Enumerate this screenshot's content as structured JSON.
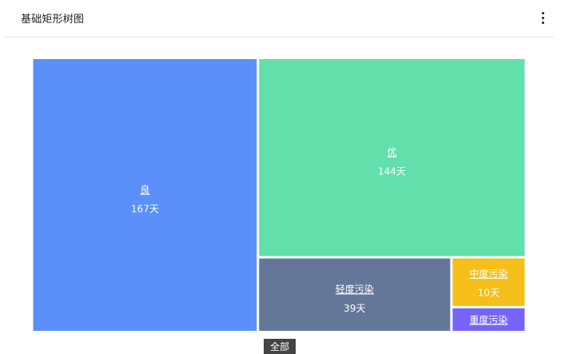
{
  "header": {
    "title": "基础矩形树图",
    "menu_icon": "more-vertical-icon"
  },
  "breadcrumb": {
    "label": "全部"
  },
  "chart_data": {
    "type": "treemap",
    "unit": "天",
    "items": [
      {
        "name": "良",
        "value": 167,
        "value_label": "167天",
        "color": "#5b8ff9"
      },
      {
        "name": "优",
        "value": 144,
        "value_label": "144天",
        "color": "#62dfab"
      },
      {
        "name": "轻度污染",
        "value": 39,
        "value_label": "39天",
        "color": "#657798"
      },
      {
        "name": "中度污染",
        "value": 10,
        "value_label": "10天",
        "color": "#f6be18"
      },
      {
        "name": "重度污染",
        "value": 5,
        "value_label": "",
        "color": "#7664fa"
      }
    ]
  }
}
